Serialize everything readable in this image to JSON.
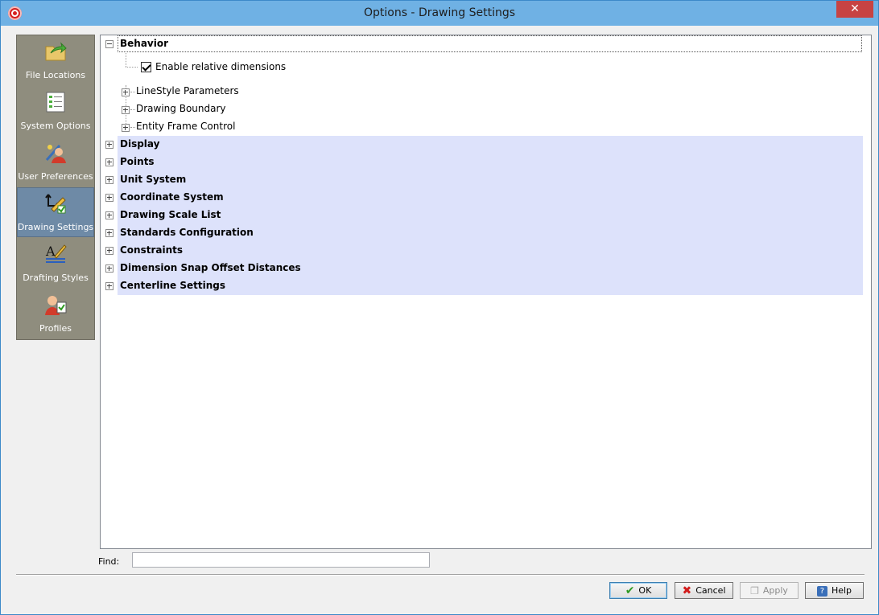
{
  "window": {
    "title": "Options - Drawing Settings",
    "close_glyph": "✕"
  },
  "nav": {
    "items": [
      {
        "label": "File Locations",
        "icon": "folder-arrow-icon"
      },
      {
        "label": "System Options",
        "icon": "settings-list-icon"
      },
      {
        "label": "User Preferences",
        "icon": "user-prefs-icon"
      },
      {
        "label": "Drawing Settings",
        "icon": "drawing-settings-icon",
        "selected": true
      },
      {
        "label": "Drafting Styles",
        "icon": "drafting-styles-icon"
      },
      {
        "label": "Profiles",
        "icon": "profiles-icon"
      }
    ]
  },
  "tree": {
    "behavior": {
      "label": "Behavior",
      "checkbox_label": "Enable relative dimensions",
      "checked": true,
      "children": [
        "LineStyle Parameters",
        "Drawing Boundary",
        "Entity Frame Control"
      ]
    },
    "sections": [
      "Display",
      "Points",
      "Unit System",
      "Coordinate System",
      "Drawing Scale List",
      "Standards Configuration",
      "Constraints",
      "Dimension Snap Offset Distances",
      "Centerline Settings"
    ],
    "highlight_color": "#dde2fb"
  },
  "find": {
    "label": "Find:",
    "value": ""
  },
  "buttons": {
    "ok": "OK",
    "cancel": "Cancel",
    "apply": "Apply",
    "help": "Help"
  },
  "colors": {
    "titlebar": "#6fb1e4",
    "nav_bg": "#8f8d7e",
    "nav_selected": "#6e8aa6",
    "close": "#c74343"
  }
}
